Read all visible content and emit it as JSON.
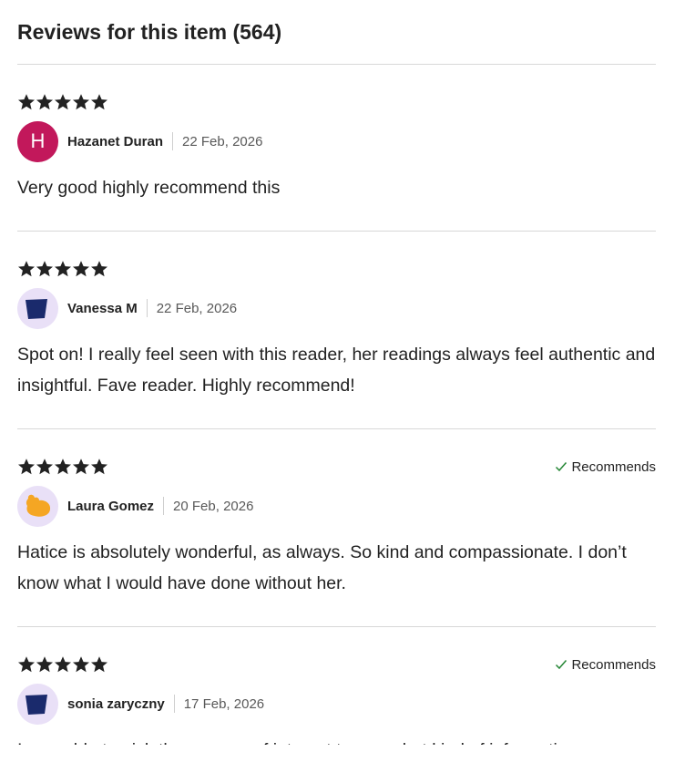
{
  "header": {
    "title": "Reviews for this item (564)"
  },
  "reviews": [
    {
      "rating": 5,
      "recommends": false,
      "avatar_type": "letter",
      "avatar_letter": "H",
      "avatar_icon": "letter-avatar",
      "name": "Hazanet Duran",
      "date": "22 Feb, 2026",
      "text": "Very good highly recommend this"
    },
    {
      "rating": 5,
      "recommends": false,
      "avatar_type": "icon",
      "avatar_icon": "navy-shape-avatar",
      "name": "Vanessa M",
      "date": "22 Feb, 2026",
      "text": "Spot on! I really feel seen with this reader, her readings always feel authentic and insightful. Fave reader. Highly recommend!"
    },
    {
      "rating": 5,
      "recommends": true,
      "recommends_label": "Recommends",
      "avatar_type": "icon",
      "avatar_icon": "orange-blob-avatar",
      "name": "Laura Gomez",
      "date": "20 Feb, 2026",
      "text": "Hatice is absolutely wonderful, as always. So kind and compassionate. I don’t know what I would have done without her."
    },
    {
      "rating": 5,
      "recommends": true,
      "recommends_label": "Recommends",
      "avatar_type": "icon",
      "avatar_icon": "navy-shape-avatar",
      "name": "sonia zaryczny",
      "date": "17 Feb, 2026",
      "text": "I was able to pick three areas of interest to see what kind of information"
    }
  ],
  "colors": {
    "star": "#222222",
    "check": "#258635",
    "avatar_letter_bg": "#c2185b",
    "avatar_lilac_bg": "#e9e0f7",
    "navy_shape": "#1a2a6c",
    "orange_blob": "#f5a623"
  }
}
